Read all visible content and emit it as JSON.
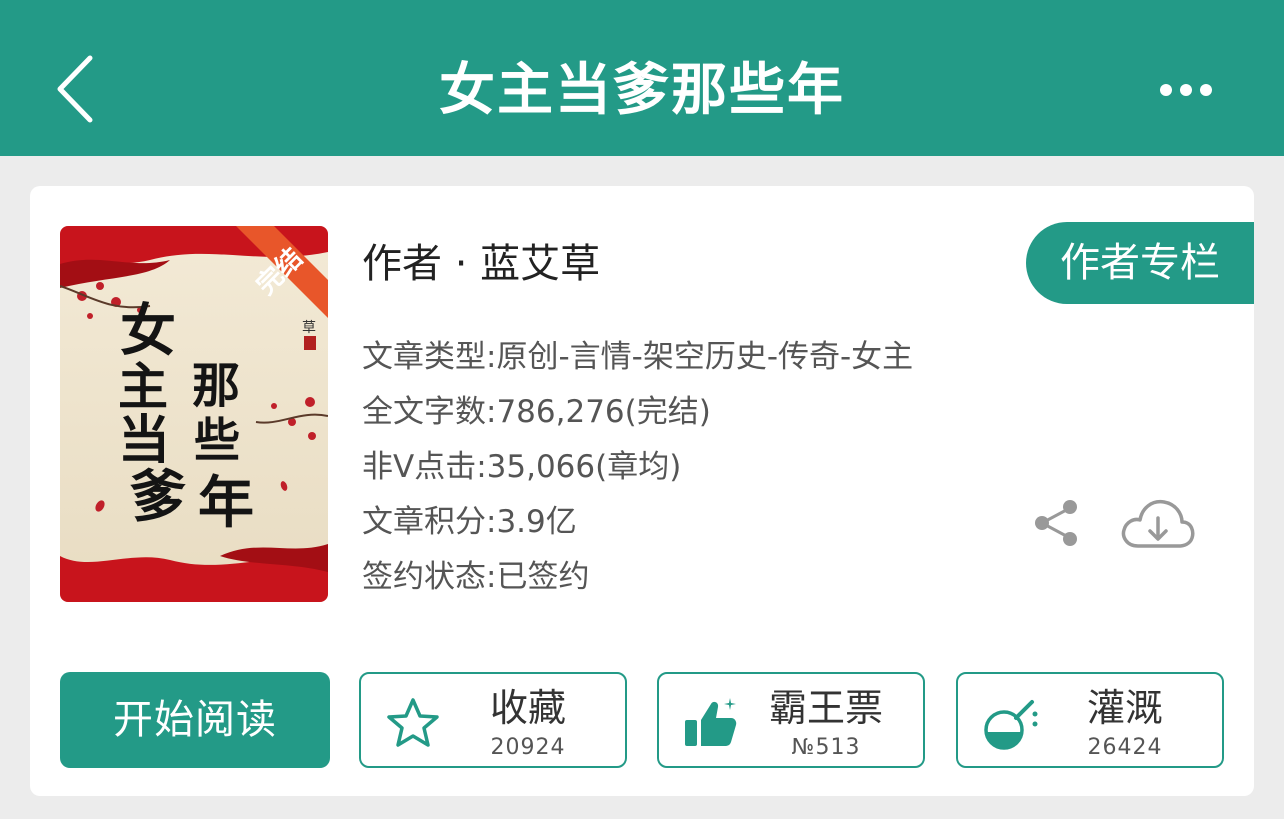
{
  "header": {
    "title": "女主当爹那些年"
  },
  "icons": {
    "back": "chevron-left-icon",
    "more": "more-horizontal-icon",
    "share": "share-icon",
    "download": "cloud-download-icon",
    "star": "star-icon",
    "thumb": "thumbs-up-icon",
    "flask": "flask-icon"
  },
  "colors": {
    "primary": "#239a87",
    "badge": "#e8562a",
    "cover_red": "#c8141c"
  },
  "book": {
    "cover": {
      "title_chars": [
        "女",
        "主",
        "当",
        "爹",
        "那",
        "些",
        "年"
      ],
      "badge": "完结",
      "author_mark": "草"
    },
    "author_line": "作者 · 蓝艾草",
    "author_column_button": "作者专栏",
    "info": [
      "文章类型:原创-言情-架空历史-传奇-女主",
      "全文字数:786,276(完结)",
      "非Ⅴ点击:35,066(章均)",
      "文章积分:3.9亿",
      "签约状态:已签约"
    ]
  },
  "actions": {
    "read": "开始阅读",
    "collect": {
      "label": "收藏",
      "count": "20924"
    },
    "vote": {
      "label": "霸王票",
      "count": "№513"
    },
    "water": {
      "label": "灌溉",
      "count": "26424"
    }
  }
}
